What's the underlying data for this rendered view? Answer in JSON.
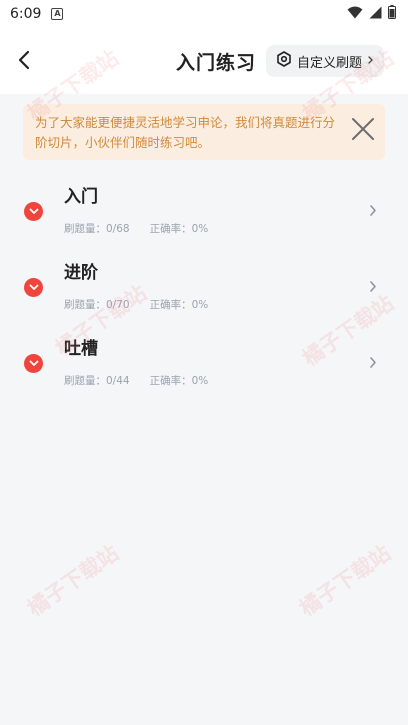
{
  "status_bar": {
    "time": "6:09",
    "app_icon_letter": "A"
  },
  "header": {
    "title": "入门练习",
    "custom_button_label": "自定义刷题"
  },
  "notice": {
    "text": "为了大家能更便捷灵活地学习申论，我们将真题进行分阶切片，小伙伴们随时练习吧。"
  },
  "levels": [
    {
      "title": "入门",
      "count_text": "刷题量：0/68",
      "accuracy_text": "正确率：0%"
    },
    {
      "title": "进阶",
      "count_text": "刷题量：0/70",
      "accuracy_text": "正确率：0%"
    },
    {
      "title": "吐槽",
      "count_text": "刷题量：0/44",
      "accuracy_text": "正确率：0%"
    }
  ],
  "watermark_text": "橘子下载站",
  "colors": {
    "accent_red": "#f0453c",
    "notice_bg": "#fbeee0",
    "notice_text": "#d08a3c",
    "meta_text": "#9ba3b1"
  }
}
